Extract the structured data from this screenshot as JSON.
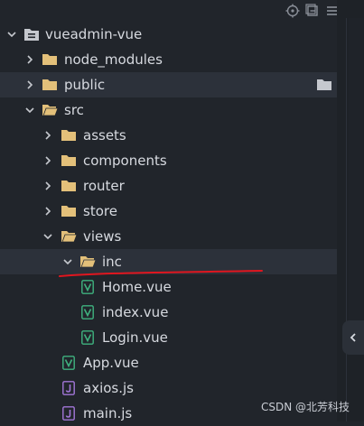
{
  "tree": {
    "root": {
      "label": "vueadmin-vue"
    },
    "items": [
      {
        "label": "node_modules"
      },
      {
        "label": "public"
      },
      {
        "label": "src"
      },
      {
        "label": "assets"
      },
      {
        "label": "components"
      },
      {
        "label": "router"
      },
      {
        "label": "store"
      },
      {
        "label": "views"
      },
      {
        "label": "inc"
      },
      {
        "label": "Home.vue"
      },
      {
        "label": "index.vue"
      },
      {
        "label": "Login.vue"
      },
      {
        "label": "App.vue"
      },
      {
        "label": "axios.js"
      },
      {
        "label": "main.js"
      }
    ]
  },
  "watermark": "CSDN @北芳科技",
  "colors": {
    "background": "#21252b",
    "folder": "#e3c07a",
    "vue_icon": "#3fb27f",
    "js_icon": "#a276d8",
    "annotation": "#e0161f"
  }
}
